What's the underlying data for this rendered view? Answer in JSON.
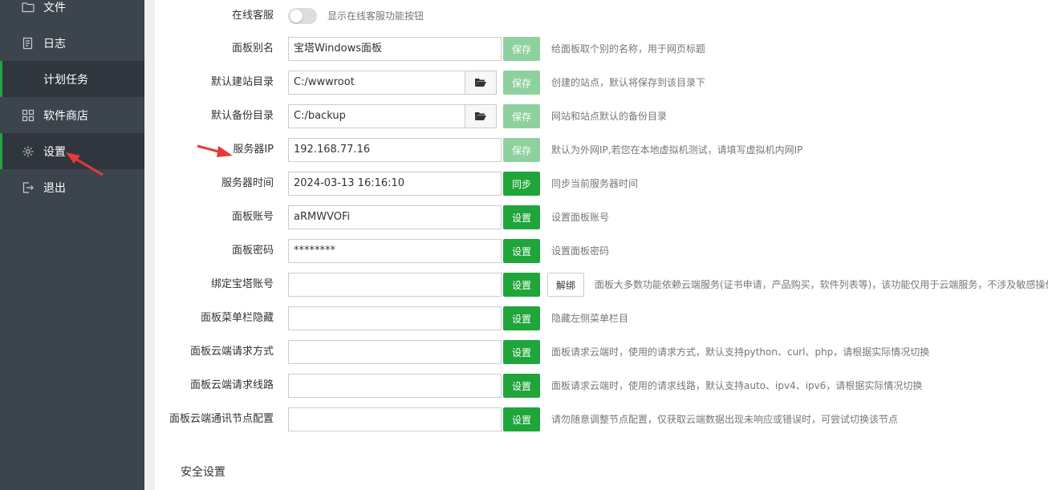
{
  "sidebar": {
    "items": [
      {
        "label": "文件",
        "icon": "folder-icon"
      },
      {
        "label": "日志",
        "icon": "log-icon"
      },
      {
        "label": "计划任务",
        "icon": ""
      },
      {
        "label": "软件商店",
        "icon": "grid-icon"
      },
      {
        "label": "设置",
        "icon": "gear-icon"
      },
      {
        "label": "退出",
        "icon": "logout-icon"
      }
    ]
  },
  "settings": {
    "online_service": {
      "label": "在线客服",
      "desc": "显示在线客服功能按钮"
    },
    "panel_alias": {
      "label": "面板别名",
      "value": "宝塔Windows面板",
      "button": "保存",
      "desc": "给面板取个别的名称，用于网页标题"
    },
    "site_dir": {
      "label": "默认建站目录",
      "value": "C:/wwwroot",
      "button": "保存",
      "desc": "创建的站点，默认将保存到该目录下"
    },
    "backup_dir": {
      "label": "默认备份目录",
      "value": "C:/backup",
      "button": "保存",
      "desc": "网站和站点默认的备份目录"
    },
    "server_ip": {
      "label": "服务器IP",
      "value": "192.168.77.16",
      "button": "保存",
      "desc": "默认为外网IP,若您在本地虚拟机测试，请填写虚拟机内网IP"
    },
    "server_time": {
      "label": "服务器时间",
      "value": "2024-03-13 16:16:10",
      "button": "同步",
      "desc": "同步当前服务器时间"
    },
    "panel_account": {
      "label": "面板账号",
      "value": "aRMWVOFi",
      "button": "设置",
      "desc": "设置面板账号"
    },
    "panel_password": {
      "label": "面板密码",
      "value": "********",
      "button": "设置",
      "desc": "设置面板密码"
    },
    "bind_account": {
      "label": "绑定宝塔账号",
      "value": "",
      "button": "设置",
      "unbind": "解绑",
      "desc": "面板大多数功能依赖云端服务(证书申请，产品购买，软件列表等)，该功能仅用于云端服务，不涉及敏感操作"
    },
    "menu_hide": {
      "label": "面板菜单栏隐藏",
      "value": "",
      "button": "设置",
      "desc": "隐藏左侧菜单栏目"
    },
    "cloud_method": {
      "label": "面板云端请求方式",
      "value": "",
      "button": "设置",
      "desc": "面板请求云端时，使用的请求方式，默认支持python、curl、php，请根据实际情况切换"
    },
    "cloud_route": {
      "label": "面板云端请求线路",
      "value": "",
      "button": "设置",
      "desc": "面板请求云端时，使用的请求线路，默认支持auto、ipv4、ipv6，请根据实际情况切换"
    },
    "cloud_node": {
      "label": "面板云端通讯节点配置",
      "value": "",
      "button": "设置",
      "desc": "请勿随意调整节点配置，仅获取云端数据出现未响应或错误时，可尝试切换该节点"
    }
  },
  "security_section": {
    "title": "安全设置"
  },
  "colors": {
    "accent": "#20a53a",
    "sidebar": "#3c444d",
    "sidebar_active": "#2f363e",
    "annotation": "#e8393a"
  }
}
